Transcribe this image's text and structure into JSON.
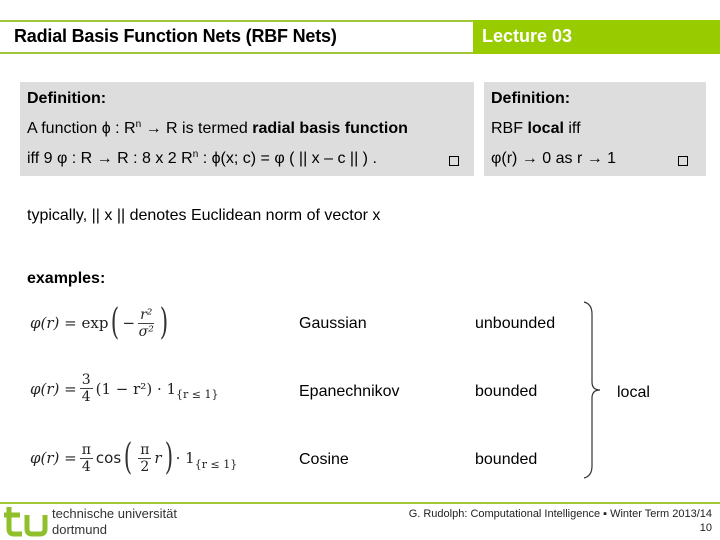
{
  "header": {
    "title": "Radial Basis Function Nets (RBF Nets)",
    "lecture": "Lecture 03",
    "accent_color": "#99cc00"
  },
  "definition_left": {
    "heading": "Definition:",
    "line1_pre": "A function ϕ : R",
    "line1_sup": "n",
    "line1_mid": " → R is termed ",
    "line1_bold": "radial basis function",
    "line2_pre": "iff 9 φ : R → R : 8 x 2 R",
    "line2_sup": "n",
    "line2_post": " : ϕ(x; c) = φ ( || x – c || ) ."
  },
  "definition_right": {
    "heading": "Definition:",
    "line1_pre": "RBF ",
    "line1_bold": "local",
    "line1_post": " iff",
    "line2": "φ(r) → 0 as r → 1"
  },
  "note": "typically, || x || denotes Euclidean norm of vector x",
  "examples_heading": "examples:",
  "examples": [
    {
      "name": "Gaussian",
      "boundedness": "unbounded",
      "formula": {
        "lhs": "φ(r) =",
        "func": "exp",
        "num": "r²",
        "den": "σ²"
      }
    },
    {
      "name": "Epanechnikov",
      "boundedness": "bounded",
      "formula": {
        "lhs": "φ(r) =",
        "num": "3",
        "den": "4",
        "body": "(1 − r²) · 1",
        "sub": "{r ≤ 1}"
      }
    },
    {
      "name": "Cosine",
      "boundedness": "bounded",
      "formula": {
        "lhs": "φ(r) =",
        "num": "π",
        "den": "4",
        "func": "cos",
        "inner_num": "π",
        "inner_den": "2",
        "inner_var": "r",
        "tail": "· 1",
        "sub": "{r ≤ 1}"
      }
    }
  ],
  "group_label": "local",
  "footer": {
    "university_line1": "technische universität",
    "university_line2": "dortmund",
    "logo_text": "tu",
    "credit": "G. Rudolph: Computational Intelligence ▪ Winter Term 2013/14",
    "page_number": "10"
  }
}
